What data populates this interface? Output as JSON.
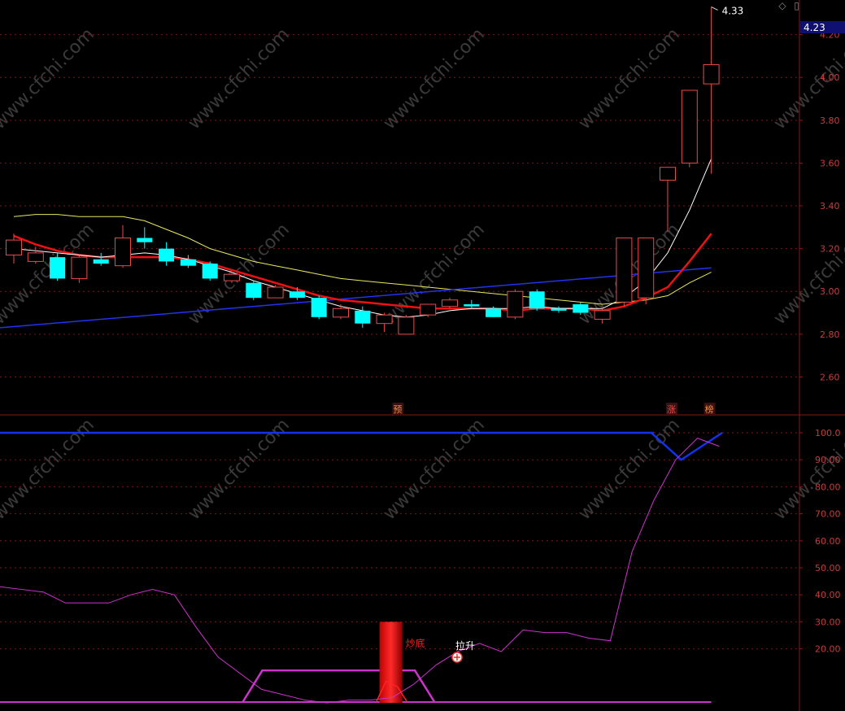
{
  "price_badge": "4.23",
  "peak_label": "4.33",
  "marks": {
    "yu": "预",
    "zhang": "涨",
    "bang": "榜",
    "lasheng": "拉升",
    "caopan": "炒底"
  },
  "watermark": "www.cfchi.com",
  "icons": {
    "diamond": "diamond-icon",
    "square": "square-icon"
  },
  "colors": {
    "up": "#e84a4a",
    "down": "#00ffff",
    "ma_white": "#ffffff",
    "ma_red": "#ee1111",
    "ma_yellow": "#e8e860",
    "ma_blue": "#2233ee",
    "grid": "#7a1818",
    "axis_text": "#c83c3c",
    "magenta": "#cc33cc",
    "osc_blue": "#1133ee",
    "badge_bg": "#101070"
  },
  "chart_data": [
    {
      "type": "candlestick",
      "title": "",
      "yticks": [
        "4.20",
        "4.00",
        "3.80",
        "3.60",
        "3.40",
        "3.20",
        "3.00",
        "2.80",
        "2.60"
      ],
      "ylim": [
        2.49,
        4.43
      ],
      "grid": true,
      "candles": [
        {
          "o": 3.17,
          "c": 3.24,
          "h": 3.27,
          "l": 3.13
        },
        {
          "o": 3.14,
          "c": 3.18,
          "h": 3.21,
          "l": 3.13
        },
        {
          "o": 3.16,
          "c": 3.06,
          "h": 3.18,
          "l": 3.05
        },
        {
          "o": 3.06,
          "c": 3.16,
          "h": 3.17,
          "l": 3.04
        },
        {
          "o": 3.15,
          "c": 3.13,
          "h": 3.18,
          "l": 3.12
        },
        {
          "o": 3.12,
          "c": 3.25,
          "h": 3.31,
          "l": 3.11
        },
        {
          "o": 3.25,
          "c": 3.23,
          "h": 3.3,
          "l": 3.2
        },
        {
          "o": 3.2,
          "c": 3.14,
          "h": 3.23,
          "l": 3.12
        },
        {
          "o": 3.15,
          "c": 3.12,
          "h": 3.17,
          "l": 3.11
        },
        {
          "o": 3.13,
          "c": 3.06,
          "h": 3.14,
          "l": 3.05
        },
        {
          "o": 3.05,
          "c": 3.08,
          "h": 3.09,
          "l": 3.04
        },
        {
          "o": 3.04,
          "c": 2.97,
          "h": 3.05,
          "l": 2.96
        },
        {
          "o": 2.97,
          "c": 3.02,
          "h": 3.03,
          "l": 2.97
        },
        {
          "o": 3.0,
          "c": 2.97,
          "h": 3.02,
          "l": 2.96
        },
        {
          "o": 2.97,
          "c": 2.88,
          "h": 2.98,
          "l": 2.87
        },
        {
          "o": 2.88,
          "c": 2.92,
          "h": 2.94,
          "l": 2.87
        },
        {
          "o": 2.91,
          "c": 2.85,
          "h": 2.93,
          "l": 2.83
        },
        {
          "o": 2.85,
          "c": 2.89,
          "h": 2.9,
          "l": 2.81
        },
        {
          "o": 2.8,
          "c": 2.88,
          "h": 2.89,
          "l": 2.8
        },
        {
          "o": 2.89,
          "c": 2.94,
          "h": 2.94,
          "l": 2.88
        },
        {
          "o": 2.93,
          "c": 2.96,
          "h": 2.97,
          "l": 2.92
        },
        {
          "o": 2.94,
          "c": 2.93,
          "h": 2.96,
          "l": 2.92
        },
        {
          "o": 2.92,
          "c": 2.88,
          "h": 2.93,
          "l": 2.88
        },
        {
          "o": 2.88,
          "c": 3.0,
          "h": 3.01,
          "l": 2.87
        },
        {
          "o": 3.0,
          "c": 2.92,
          "h": 3.01,
          "l": 2.91
        },
        {
          "o": 2.92,
          "c": 2.91,
          "h": 2.93,
          "l": 2.9
        },
        {
          "o": 2.94,
          "c": 2.9,
          "h": 2.95,
          "l": 2.89
        },
        {
          "o": 2.87,
          "c": 2.91,
          "h": 2.92,
          "l": 2.85
        },
        {
          "o": 2.95,
          "c": 3.25,
          "h": 3.25,
          "l": 2.93
        },
        {
          "o": 2.97,
          "c": 3.25,
          "h": 3.25,
          "l": 2.94
        },
        {
          "o": 3.52,
          "c": 3.58,
          "h": 3.58,
          "l": 3.28
        },
        {
          "o": 3.6,
          "c": 3.94,
          "h": 3.94,
          "l": 3.58
        },
        {
          "o": 3.97,
          "c": 4.06,
          "h": 4.33,
          "l": 3.55
        }
      ],
      "ma_white": [
        3.2,
        3.19,
        3.18,
        3.17,
        3.16,
        3.17,
        3.18,
        3.17,
        3.15,
        3.12,
        3.09,
        3.05,
        3.02,
        2.99,
        2.96,
        2.93,
        2.91,
        2.89,
        2.88,
        2.89,
        2.91,
        2.92,
        2.92,
        2.92,
        2.93,
        2.92,
        2.92,
        2.92,
        2.97,
        3.05,
        3.18,
        3.38,
        3.62
      ],
      "ma_red": [
        3.26,
        3.22,
        3.19,
        3.17,
        3.16,
        3.16,
        3.16,
        3.16,
        3.15,
        3.13,
        3.1,
        3.07,
        3.04,
        3.01,
        2.98,
        2.96,
        2.95,
        2.94,
        2.93,
        2.92,
        2.92,
        2.92,
        2.92,
        2.91,
        2.92,
        2.92,
        2.92,
        2.91,
        2.93,
        2.97,
        3.02,
        3.14,
        3.27
      ],
      "ma_yellow": [
        3.35,
        3.36,
        3.36,
        3.35,
        3.35,
        3.35,
        3.33,
        3.29,
        3.25,
        3.2,
        3.17,
        3.14,
        3.12,
        3.1,
        3.08,
        3.06,
        3.05,
        3.04,
        3.03,
        3.02,
        3.01,
        3.0,
        2.99,
        2.98,
        2.97,
        2.96,
        2.95,
        2.94,
        2.95,
        2.96,
        2.98,
        3.04,
        3.09
      ],
      "ma_blue_start": 2.83,
      "ma_blue_end": 3.11
    },
    {
      "type": "line",
      "yticks": [
        "100.0",
        "90.00",
        "80.00",
        "70.00",
        "60.00",
        "50.00",
        "40.00",
        "30.00",
        "20.00"
      ],
      "ylim": [
        0,
        106
      ],
      "grid": true,
      "series": [
        {
          "color": "magenta",
          "values": [
            43,
            42,
            41,
            37,
            37,
            37,
            40,
            42,
            40,
            28,
            17,
            11,
            5,
            3,
            1,
            0,
            1,
            1,
            2,
            7,
            14,
            19,
            22,
            19,
            27,
            26,
            26,
            24,
            23,
            56,
            75,
            90,
            98,
            95
          ]
        },
        {
          "color": "blue",
          "values": [
            100,
            100,
            100,
            100,
            100,
            100,
            100,
            100,
            100,
            100,
            100,
            100,
            100,
            100,
            100,
            100,
            100,
            100,
            100,
            100,
            100,
            100,
            100,
            100,
            100,
            100,
            100,
            100,
            100,
            100,
            100,
            100,
            90,
            100
          ]
        }
      ],
      "trapezoid": {
        "x_start": 10.5,
        "x_top_start": 11.4,
        "x_top_end": 18.4,
        "x_end": 19.3,
        "y_top": 12
      },
      "bar": {
        "x": 17.3,
        "value": 30
      }
    }
  ]
}
